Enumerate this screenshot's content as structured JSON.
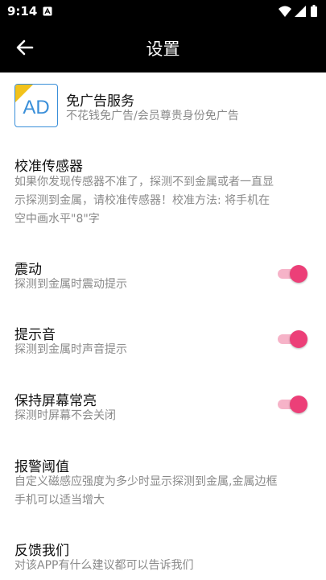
{
  "status": {
    "time": "9:14"
  },
  "header": {
    "title": "设置"
  },
  "items": {
    "ad": {
      "title": "免广告服务",
      "subtitle": "不花钱免广告/会员尊贵身份免广告",
      "icon_text": "AD"
    },
    "calibrate": {
      "title": "校准传感器",
      "desc_line1": "如果你发现传感器不准了，探测不到金属或者一直显",
      "desc_line2": "示探测到金属，请校准传感器！校准方法: 将手机在",
      "desc_line3": "空中画水平\"8\"字"
    },
    "vibrate": {
      "title": "震动",
      "subtitle": "探测到金属时震动提示",
      "enabled": true
    },
    "sound": {
      "title": "提示音",
      "subtitle": "探测到金属时声音提示",
      "enabled": true
    },
    "screen": {
      "title": "保持屏幕常亮",
      "subtitle": "探测时屏幕不会关闭",
      "enabled": true
    },
    "threshold": {
      "title": "报警阈值",
      "desc_line1": "自定义磁感应强度为多少时显示探测到金属,金属边框",
      "desc_line2": "手机可以适当增大"
    },
    "feedback": {
      "title": "反馈我们",
      "subtitle": "对该APP有什么建议都可以告诉我们"
    }
  },
  "colors": {
    "accent": "#ec3f78",
    "track": "#f6b3c8",
    "ad_blue": "#3a8fd9",
    "ad_badge": "#f2c21b"
  }
}
